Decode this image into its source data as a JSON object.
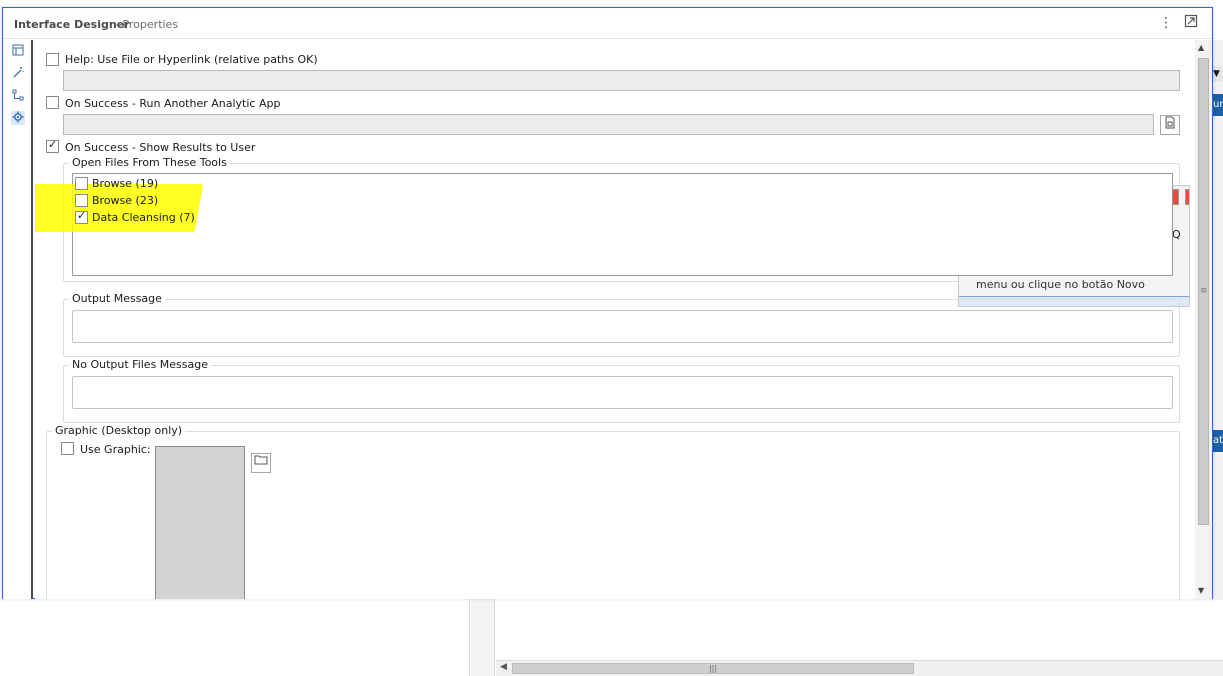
{
  "panel": {
    "title": "Interface Designer",
    "subtitle": "- Properties"
  },
  "header_icons": [
    "more-options-icon",
    "restore-window-icon"
  ],
  "rail_icons": [
    "layout-icon",
    "magic-wand-icon",
    "tree-view-icon",
    "gear-icon"
  ],
  "help": {
    "label": "Help: Use File or Hyperlink (relative paths OK)",
    "checked": false,
    "value": ""
  },
  "on_success_run": {
    "label": "On Success - Run Another Analytic App",
    "checked": false,
    "value": "",
    "browse_icon": "file-browse-icon"
  },
  "on_success_show": {
    "label": "On Success - Show Results to User",
    "checked": true
  },
  "open_files": {
    "title": "Open Files From These Tools",
    "items": [
      {
        "label": "Browse (19)",
        "checked": false
      },
      {
        "label": "Browse (23)",
        "checked": false
      },
      {
        "label": "Data Cleansing (7)",
        "checked": true
      }
    ]
  },
  "output_message": {
    "title": "Output Message",
    "value": ""
  },
  "no_output_message": {
    "title": "No Output Files Message",
    "value": ""
  },
  "graphic": {
    "title": "Graphic (Desktop only)",
    "use_label": "Use Graphic:",
    "checked": false,
    "folder_icon": "folder-icon"
  },
  "background": {
    "ghost_text": "menu ou clique no botão Novo",
    "ghost_fragment": "Q",
    "tab_top": "ur",
    "tab_bottom": "at"
  },
  "colors": {
    "accent": "#2b6cc4",
    "highlight": "#ffff00",
    "tab_blue": "#1d5fa8"
  }
}
